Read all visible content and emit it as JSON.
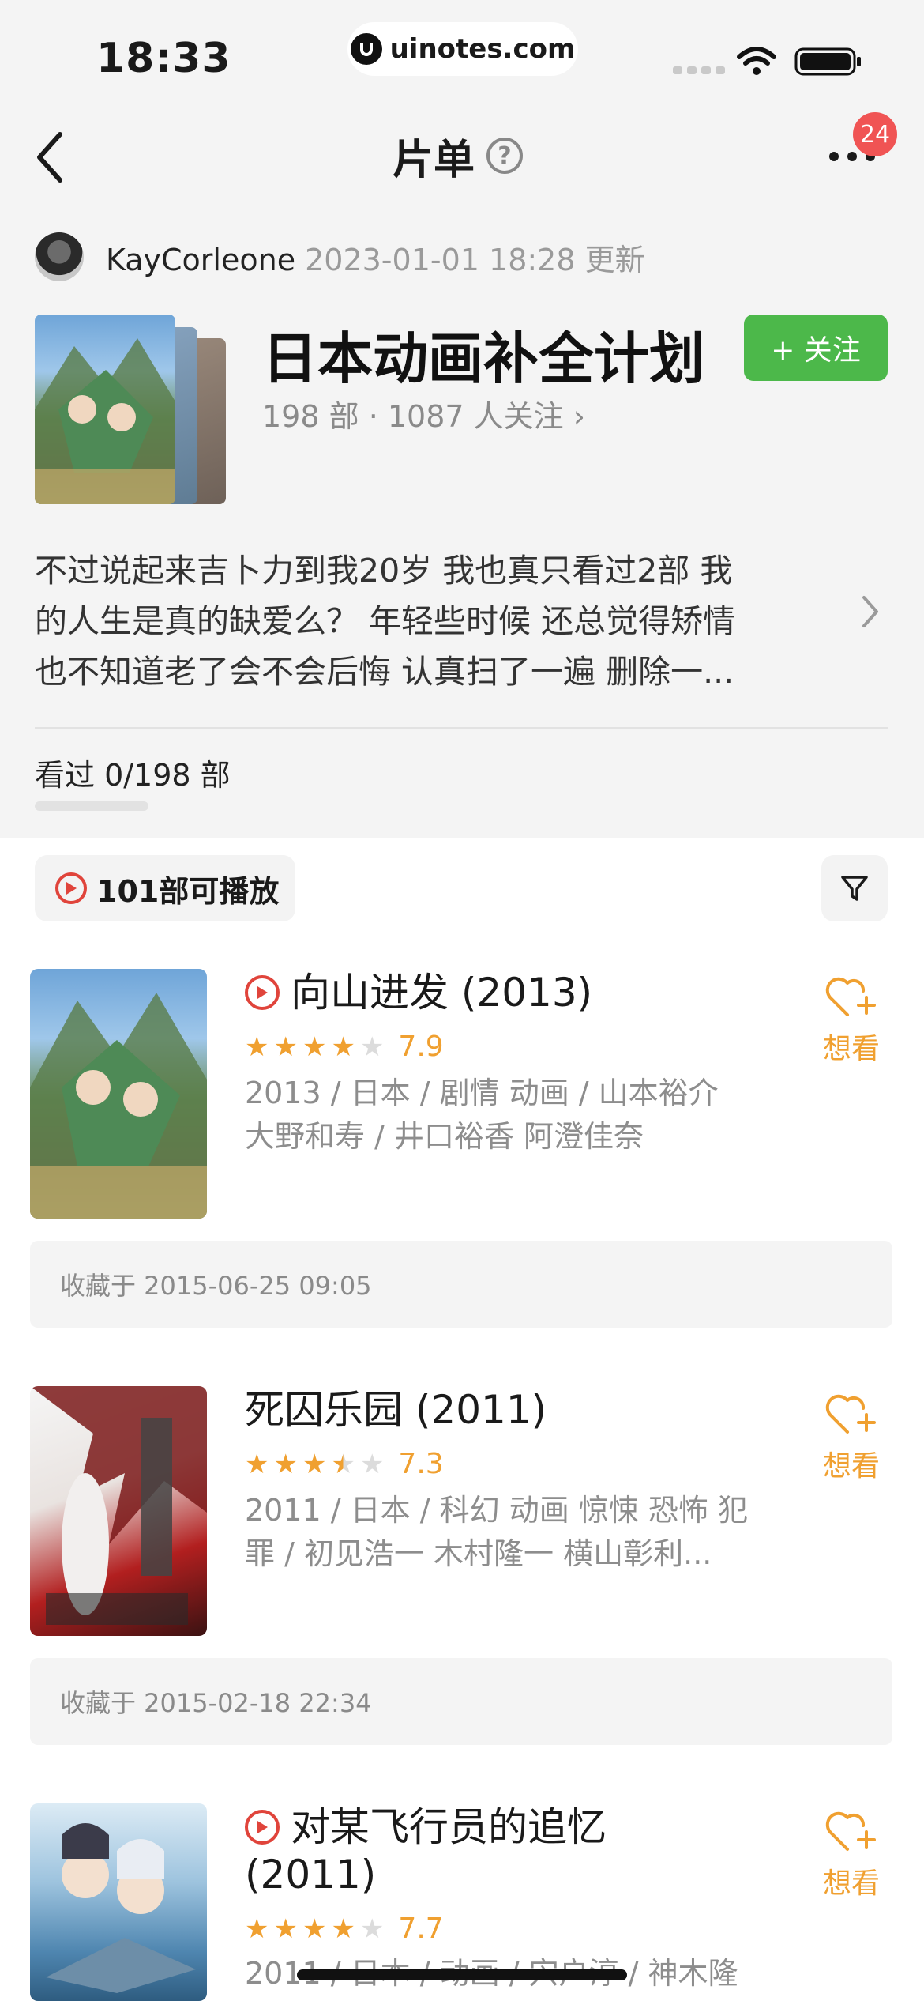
{
  "status_bar": {
    "time": "18:33",
    "url": "uinotes.com"
  },
  "nav": {
    "title": "片单",
    "help_icon": "question-circle-icon",
    "more_icon": "more-dots-icon",
    "badge_count": "24"
  },
  "author": {
    "name": "KayCorleone",
    "updated": "2023-01-01 18:28 更新"
  },
  "list": {
    "title": "日本动画补全计划",
    "follow_label": "+ 关注",
    "meta": "198 部 · 1087 人关注 ›",
    "description_lines": [
      "不过说起来吉卜力到我20岁 我也真只看过2部 我",
      "的人生是真的缺爱么？  年轻些时候 还总觉得矫情",
      "也不知道老了会不会后悔  认真扫了一遍 删除一..."
    ],
    "watched": "看过 0/198 部",
    "watched_progress": 0
  },
  "filter": {
    "playable_label": "101部可播放",
    "filter_icon": "funnel-icon"
  },
  "colors": {
    "accent_green": "#4cb84a",
    "accent_orange": "#f0a030",
    "play_red": "#e0443b",
    "badge_red": "#f05454"
  },
  "items": [
    {
      "title": "向山进发 (2013)",
      "playable": true,
      "stars": 4,
      "rating": "7.9",
      "info_lines": [
        "2013 / 日本 / 剧情 动画 / 山本裕介",
        "大野和寿 / 井口裕香 阿澄佳奈"
      ],
      "want_label": "想看",
      "collected": "收藏于 2015-06-25 09:05"
    },
    {
      "title": "死囚乐园 (2011)",
      "playable": false,
      "stars": 3.5,
      "rating": "7.3",
      "info_lines": [
        "2011 / 日本 / 科幻 动画 惊悚 恐怖 犯",
        "罪 / 初见浩一 木村隆一 横山彰利..."
      ],
      "want_label": "想看",
      "collected": "收藏于 2015-02-18 22:34"
    },
    {
      "title_line1": "对某飞行员的追忆",
      "title_line2": "(2011)",
      "playable": true,
      "stars": 4,
      "rating": "7.7",
      "info_lines": [
        "2011 / 日本 / 动画 / 宍户淳 / 神木隆"
      ],
      "want_label": "想看"
    }
  ]
}
